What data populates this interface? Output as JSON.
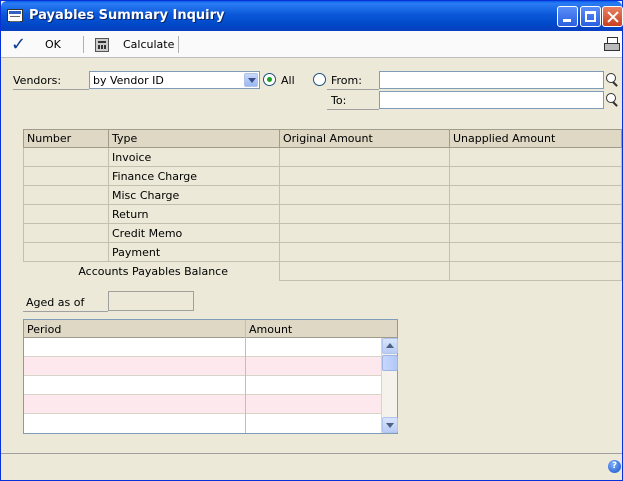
{
  "window": {
    "title": "Payables Summary Inquiry"
  },
  "toolbar": {
    "ok_label": "OK",
    "calculate_label": "Calculate"
  },
  "vendors": {
    "label": "Vendors:",
    "combo_value": "by Vendor ID",
    "all_label": "All",
    "all_selected": true,
    "from_label": "From:",
    "to_label": "To:",
    "from_value": "",
    "to_value": ""
  },
  "summary_table": {
    "columns": [
      "Number",
      "Type",
      "Original Amount",
      "Unapplied Amount"
    ],
    "rows": [
      {
        "number": "",
        "type": "Invoice",
        "original": "",
        "unapplied": ""
      },
      {
        "number": "",
        "type": "Finance Charge",
        "original": "",
        "unapplied": ""
      },
      {
        "number": "",
        "type": "Misc Charge",
        "original": "",
        "unapplied": ""
      },
      {
        "number": "",
        "type": "Return",
        "original": "",
        "unapplied": ""
      },
      {
        "number": "",
        "type": "Credit Memo",
        "original": "",
        "unapplied": ""
      },
      {
        "number": "",
        "type": "Payment",
        "original": "",
        "unapplied": ""
      }
    ],
    "balance_label": "Accounts Payables Balance"
  },
  "aged": {
    "label": "Aged as of",
    "value": ""
  },
  "period_table": {
    "columns": [
      "Period",
      "Amount"
    ],
    "rows": [
      {
        "period": "",
        "amount": ""
      },
      {
        "period": "",
        "amount": ""
      },
      {
        "period": "",
        "amount": ""
      },
      {
        "period": "",
        "amount": ""
      },
      {
        "period": "",
        "amount": ""
      }
    ]
  },
  "icons": {
    "window": "window-app-icon",
    "ok": "checkmark-icon",
    "calculate": "calculator-icon",
    "print": "printer-icon",
    "lookup": "magnifier-icon",
    "help": "help-icon"
  },
  "colors": {
    "titlebar": "#0a58d8",
    "window_bg": "#ece9d8",
    "grid_header": "#ded8c4",
    "pink_row": "#fde8ee",
    "radio_dot": "#21a121"
  }
}
